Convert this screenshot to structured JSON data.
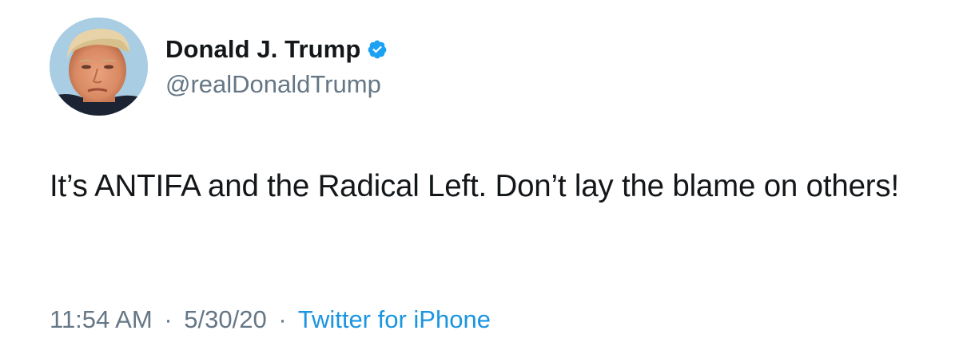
{
  "author": {
    "display_name": "Donald J. Trump",
    "handle": "@realDonaldTrump",
    "verified": true,
    "avatar_icon": "profile-photo-avatar"
  },
  "tweet": {
    "text": "It’s ANTIFA and the Radical Left. Don’t lay the blame on others!",
    "time": "11:54 AM",
    "separator": "·",
    "date": "5/30/20",
    "source": "Twitter for iPhone"
  },
  "colors": {
    "text_primary": "#14171a",
    "text_secondary": "#657786",
    "link_blue": "#1b95e0",
    "verified_blue": "#1da1f2",
    "background": "#ffffff"
  }
}
